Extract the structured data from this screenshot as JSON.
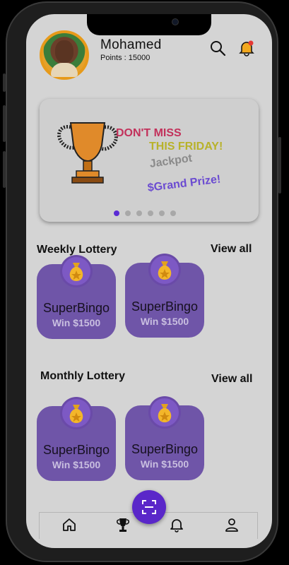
{
  "user": {
    "name": "Mohamed",
    "points_label": "Points :  15000"
  },
  "banner": {
    "line1": "DON'T MISS",
    "line2": "THIS FRIDAY!",
    "line3": "Jackpot",
    "line4": "$Grand Prize!",
    "slides": 6,
    "active_slide": 1
  },
  "weekly": {
    "title": "Weekly Lottery",
    "view_all": "View all",
    "cards": [
      {
        "title": "SuperBingo",
        "prize": "Win $1500"
      },
      {
        "title": "SuperBingo",
        "prize": "Win $1500"
      }
    ]
  },
  "monthly": {
    "title": "Monthly Lottery",
    "view_all": "View all",
    "cards": [
      {
        "title": "SuperBingo",
        "prize": "Win $1500"
      },
      {
        "title": "SuperBingo",
        "prize": "Win $1500"
      }
    ]
  },
  "nav": {
    "items": [
      "home-icon",
      "trophy-icon",
      "bell-icon",
      "user-icon"
    ],
    "center": "scan-icon"
  },
  "colors": {
    "accent": "#5a27c9",
    "card": "#6f55a8",
    "bell_dot": "#e53935"
  }
}
